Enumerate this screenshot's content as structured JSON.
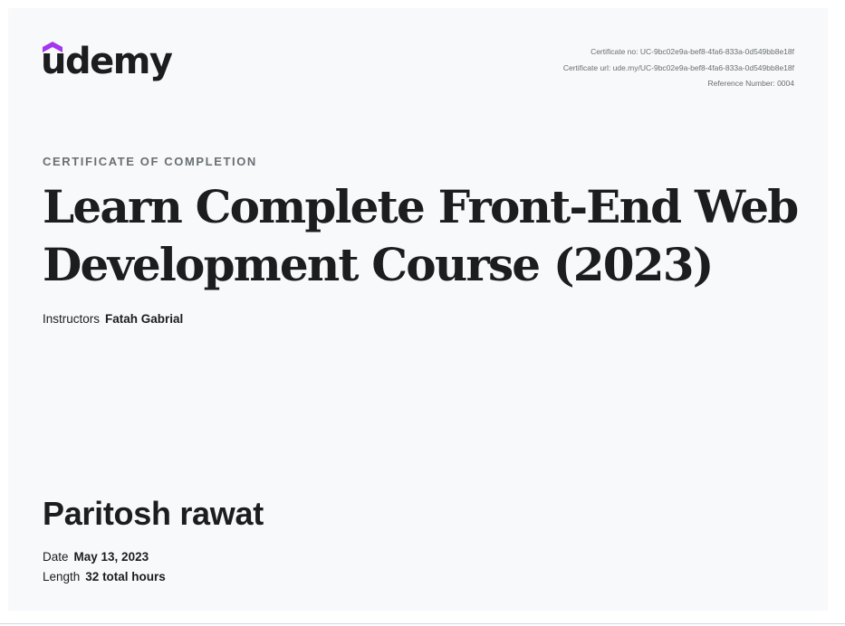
{
  "brand": {
    "logo_text": "udemy",
    "logo_accent_color": "#a435f0",
    "text_color": "#1c1d1f"
  },
  "meta": {
    "certificate_no": "Certificate no: UC-9bc02e9a-bef8-4fa6-833a-0d549bb8e18f",
    "certificate_url": "Certificate url: ude.my/UC-9bc02e9a-bef8-4fa6-833a-0d549bb8e18f",
    "reference_number": "Reference Number: 0004"
  },
  "certificate": {
    "eyebrow": "CERTIFICATE OF COMPLETION",
    "course_title": "Learn Complete Front-End Web Development Course (2023)",
    "instructors_label": "Instructors",
    "instructors_value": "Fatah Gabrial",
    "recipient_name": "Paritosh rawat",
    "date_label": "Date",
    "date_value": "May 13, 2023",
    "length_label": "Length",
    "length_value": "32 total hours"
  }
}
